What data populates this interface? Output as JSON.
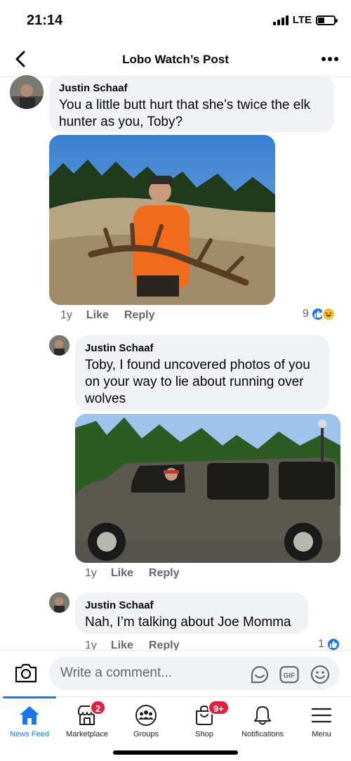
{
  "status": {
    "time": "21:14",
    "network": "LTE",
    "battery_level": 0.4
  },
  "header": {
    "title": "Lobo Watch’s Post"
  },
  "comments": [
    {
      "author": "Justin Schaaf",
      "text": "You a little butt hurt that she’s twice the elk hunter as you, Toby?",
      "age": "1y",
      "like": "Like",
      "reply": "Reply",
      "reaction_count": "9",
      "reaction_icons": [
        "like-icon",
        "haha-icon"
      ]
    },
    {
      "author": "Justin Schaaf",
      "text": "Toby, I found uncovered photos of you on your way to lie about running over wolves",
      "age": "1y",
      "like": "Like",
      "reply": "Reply"
    },
    {
      "author": "Justin Schaaf",
      "text": "Nah, I’m talking about Joe Momma",
      "age": "1y",
      "like": "Like",
      "reply": "Reply",
      "reaction_count": "1",
      "reaction_icons": [
        "like-icon"
      ]
    }
  ],
  "composer": {
    "placeholder": "Write a comment..."
  },
  "tabs": [
    {
      "label": "News Feed",
      "icon": "home-icon"
    },
    {
      "label": "Marketplace",
      "icon": "marketplace-icon",
      "badge": "2"
    },
    {
      "label": "Groups",
      "icon": "groups-icon"
    },
    {
      "label": "Shop",
      "icon": "shop-icon",
      "badge": "9+"
    },
    {
      "label": "Notifications",
      "icon": "bell-icon"
    },
    {
      "label": "Menu",
      "icon": "menu-icon"
    }
  ],
  "colors": {
    "accent": "#1877f2",
    "badge": "#e41e3f",
    "bubble": "#f0f2f5",
    "secondary_text": "#65676b"
  }
}
